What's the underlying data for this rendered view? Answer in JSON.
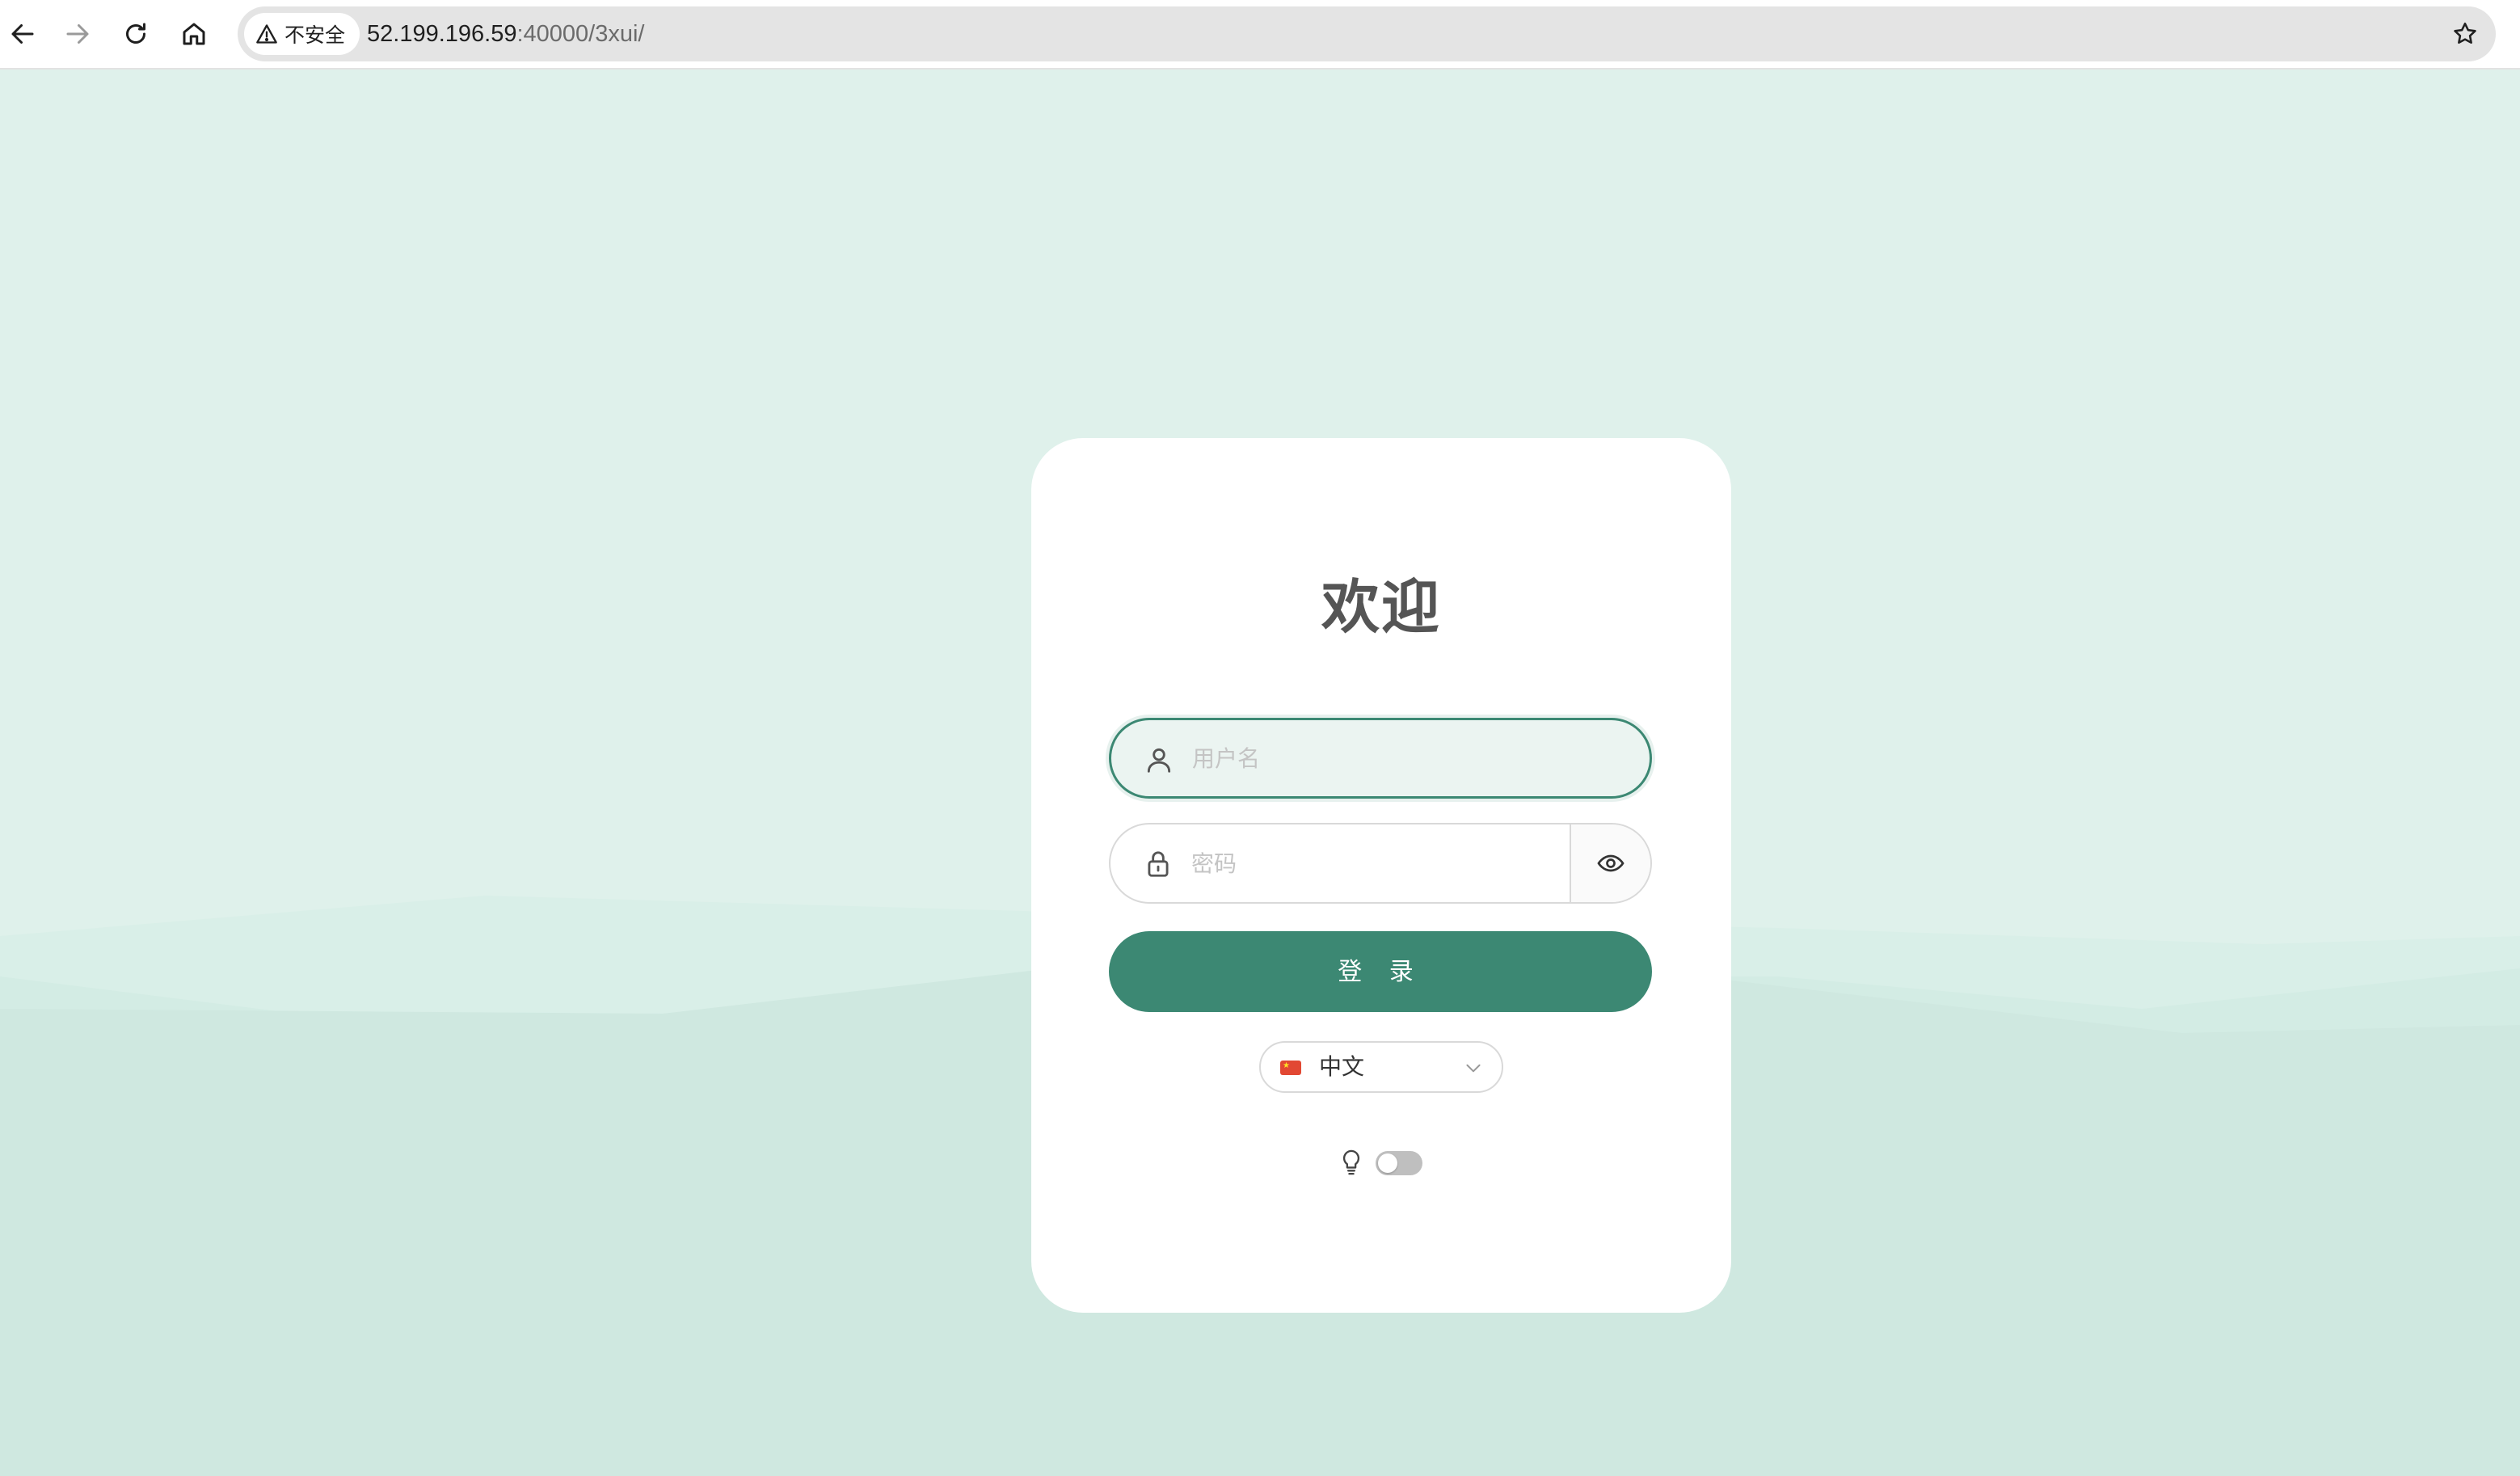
{
  "browser": {
    "security_label": "不安全",
    "url_host": "52.199.196.59",
    "url_rest": ":40000/3xui/"
  },
  "login": {
    "title": "欢迎",
    "username_placeholder": "用户名",
    "password_placeholder": "密码",
    "submit_label": "登 录",
    "language_selected": "中文",
    "theme_dark_mode_enabled": false
  },
  "icons": {
    "back": "arrow-left-icon",
    "forward": "arrow-right-icon",
    "reload": "reload-icon",
    "home": "home-icon",
    "warning": "warning-triangle-icon",
    "bookmark": "star-icon",
    "user": "user-icon",
    "lock": "lock-icon",
    "eye": "eye-icon",
    "flag": "china-flag-icon",
    "chevron": "chevron-down-icon",
    "bulb": "bulb-icon"
  },
  "colors": {
    "background": "#dff1eb",
    "primary": "#3c8873",
    "card": "#ffffff",
    "title": "#555555"
  }
}
